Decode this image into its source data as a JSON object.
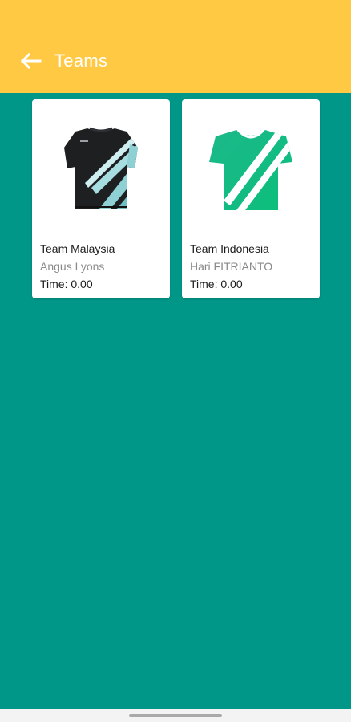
{
  "header": {
    "title": "Teams",
    "back_icon": "arrow-left-icon",
    "bar_color": "#FFC943"
  },
  "background_color": "#009688",
  "teams": [
    {
      "name": "Team Malaysia",
      "manager": "Angus Lyons",
      "time": "Time: 0.00",
      "jersey_icon": "jersey-photo-icon"
    },
    {
      "name": "Team Indonesia",
      "manager": "Hari FITRIANTO",
      "time": "Time: 0.00",
      "jersey_icon": "jersey-green-icon"
    }
  ]
}
